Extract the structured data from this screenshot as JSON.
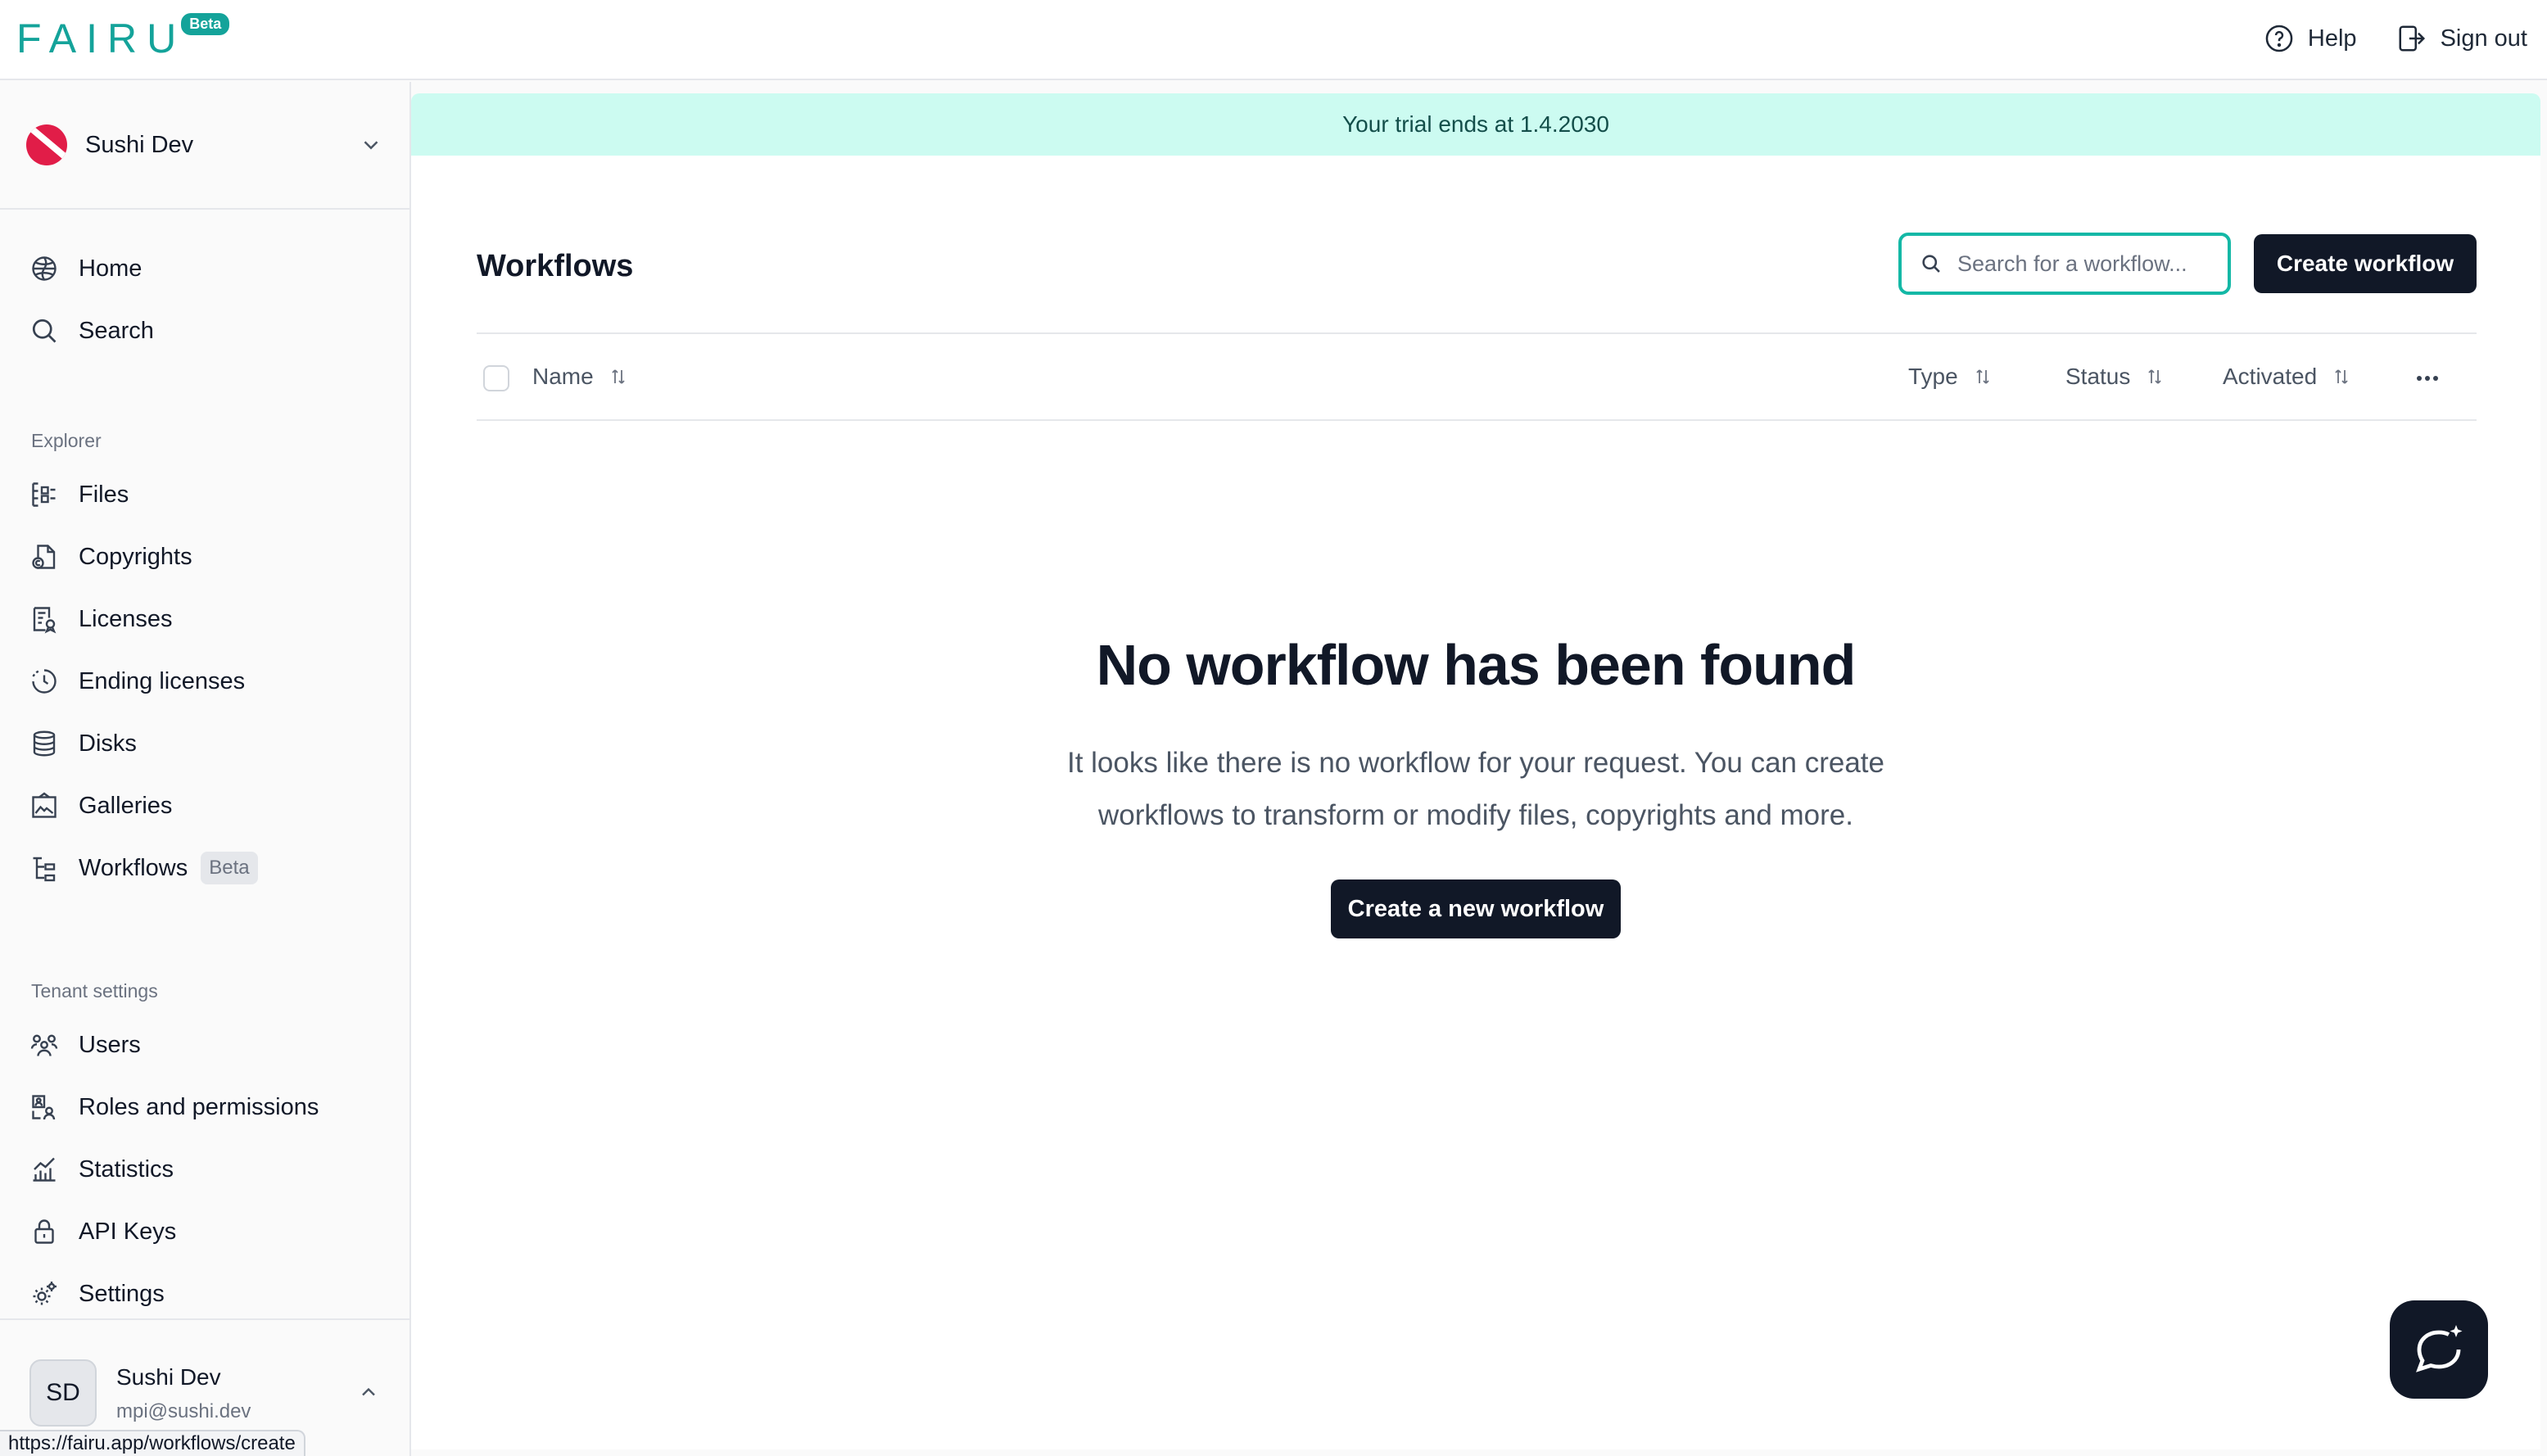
{
  "header": {
    "logo_text": "FAIRU",
    "logo_badge": "Beta",
    "help_label": "Help",
    "signout_label": "Sign out"
  },
  "sidebar": {
    "tenant_name": "Sushi Dev",
    "main_items": [
      {
        "label": "Home",
        "icon": "home-icon"
      },
      {
        "label": "Search",
        "icon": "search-icon"
      }
    ],
    "explorer_label": "Explorer",
    "explorer_items": [
      {
        "label": "Files",
        "icon": "files-icon"
      },
      {
        "label": "Copyrights",
        "icon": "copyright-icon"
      },
      {
        "label": "Licenses",
        "icon": "license-icon"
      },
      {
        "label": "Ending licenses",
        "icon": "clock-icon"
      },
      {
        "label": "Disks",
        "icon": "database-icon"
      },
      {
        "label": "Galleries",
        "icon": "gallery-icon"
      },
      {
        "label": "Workflows",
        "icon": "workflow-icon",
        "badge": "Beta"
      }
    ],
    "tenant_settings_label": "Tenant settings",
    "settings_items": [
      {
        "label": "Users",
        "icon": "users-icon"
      },
      {
        "label": "Roles and permissions",
        "icon": "roles-icon"
      },
      {
        "label": "Statistics",
        "icon": "statistics-icon"
      },
      {
        "label": "API Keys",
        "icon": "lock-icon"
      },
      {
        "label": "Settings",
        "icon": "gear-icon"
      }
    ],
    "user": {
      "initials": "SD",
      "name": "Sushi Dev",
      "email": "mpi@sushi.dev"
    }
  },
  "status_url": "https://fairu.app/workflows/create",
  "main": {
    "trial_banner": "Your trial ends at 1.4.2030",
    "page_title": "Workflows",
    "search": {
      "placeholder": "Search for a workflow...",
      "value": ""
    },
    "create_button": "Create workflow",
    "table": {
      "columns": [
        "Name",
        "Type",
        "Status",
        "Activated"
      ]
    },
    "empty": {
      "title": "No workflow has been found",
      "text": "It looks like there is no workflow for your request. You can create workflows to transform or modify files, copyrights and more.",
      "button": "Create a new workflow"
    }
  },
  "colors": {
    "brand": "#14a39a",
    "banner_bg": "#ccfbf1",
    "button_dark": "#111827",
    "search_focus": "#14b8a6"
  }
}
